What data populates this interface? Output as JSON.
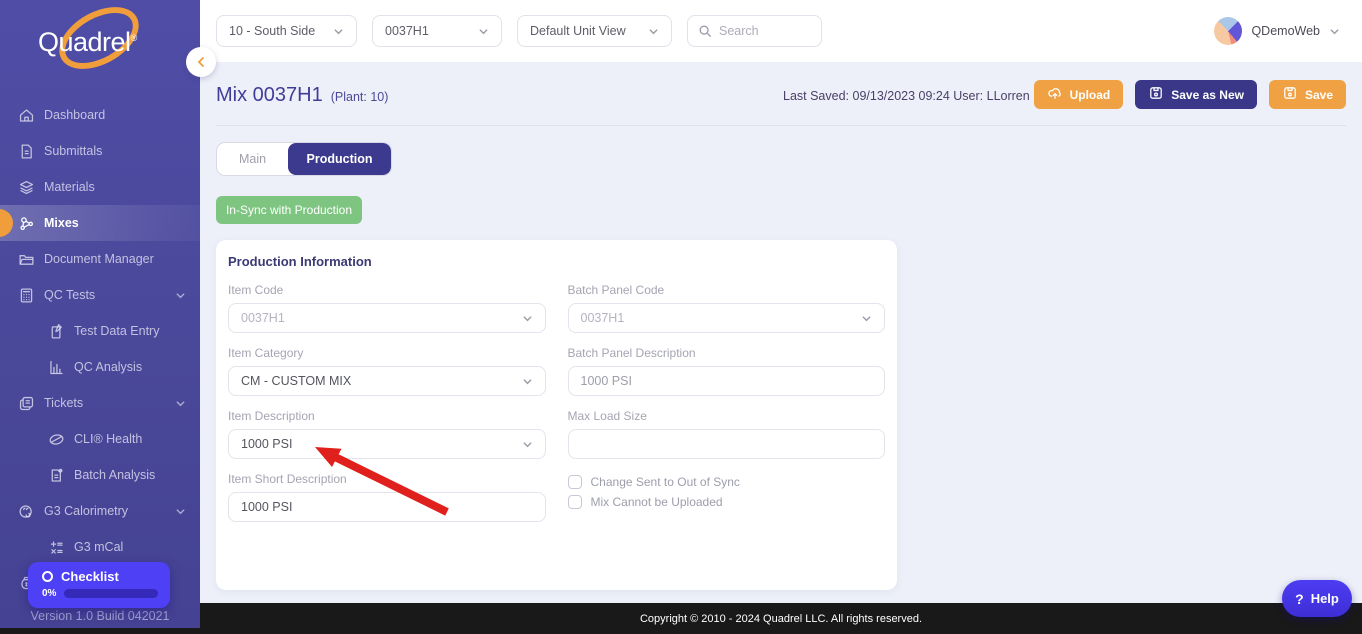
{
  "brand": {
    "logo_text": "Quadrel",
    "registered_mark": "®",
    "version": "Version 1.0 Build 042021"
  },
  "sidebar": {
    "items": [
      {
        "label": "Dashboard",
        "icon": "home-icon",
        "sub": false,
        "chevron": false,
        "active": false
      },
      {
        "label": "Submittals",
        "icon": "document-icon",
        "sub": false,
        "chevron": false,
        "active": false
      },
      {
        "label": "Materials",
        "icon": "layers-icon",
        "sub": false,
        "chevron": false,
        "active": false
      },
      {
        "label": "Mixes",
        "icon": "molecule-icon",
        "sub": false,
        "chevron": false,
        "active": true
      },
      {
        "label": "Document Manager",
        "icon": "folder-icon",
        "sub": false,
        "chevron": false,
        "active": false
      },
      {
        "label": "QC Tests",
        "icon": "calculator-icon",
        "sub": false,
        "chevron": true,
        "active": false
      },
      {
        "label": "Test Data Entry",
        "icon": "clipboard-edit-icon",
        "sub": true,
        "chevron": false,
        "active": false
      },
      {
        "label": "QC Analysis",
        "icon": "bar-chart-icon",
        "sub": true,
        "chevron": false,
        "active": false
      },
      {
        "label": "Tickets",
        "icon": "tickets-icon",
        "sub": false,
        "chevron": true,
        "active": false
      },
      {
        "label": "CLI® Health",
        "icon": "gauge-icon",
        "sub": true,
        "chevron": false,
        "active": false
      },
      {
        "label": "Batch Analysis",
        "icon": "doc-badge-icon",
        "sub": true,
        "chevron": false,
        "active": false
      },
      {
        "label": "G3 Calorimetry",
        "icon": "calorimeter-icon",
        "sub": false,
        "chevron": true,
        "active": false
      },
      {
        "label": "G3 mCal",
        "icon": "math-icon",
        "sub": true,
        "chevron": false,
        "active": false
      },
      {
        "label": "",
        "icon": "money-bag-icon",
        "sub": false,
        "chevron": false,
        "active": false
      }
    ],
    "checklist": {
      "label": "Checklist",
      "percent": "0%"
    }
  },
  "topbar": {
    "selects": [
      {
        "value": "10 - South Side"
      },
      {
        "value": "0037H1"
      },
      {
        "value": "Default Unit View"
      }
    ],
    "search_placeholder": "Search",
    "user": "QDemoWeb"
  },
  "header": {
    "title": "Mix 0037H1",
    "subtitle": "(Plant: 10)",
    "last_saved": "Last Saved: 09/13/2023 09:24 User: LLorren",
    "buttons": [
      {
        "label": "Upload",
        "icon": "cloud-upload-icon",
        "style": "orange"
      },
      {
        "label": "Save as New",
        "icon": "save-icon",
        "style": "indigo"
      },
      {
        "label": "Save",
        "icon": "save-icon",
        "style": "orange"
      }
    ]
  },
  "tabs": [
    {
      "label": "Main",
      "active": false
    },
    {
      "label": "Production",
      "active": true
    }
  ],
  "sync_badge": "In-Sync with Production",
  "form": {
    "title": "Production Information",
    "fields": [
      {
        "key": "item_code",
        "label": "Item Code",
        "value": "0037H1",
        "type": "select",
        "muted": true
      },
      {
        "key": "batch_panel_code",
        "label": "Batch Panel Code",
        "value": "0037H1",
        "type": "select",
        "muted": true
      },
      {
        "key": "item_category",
        "label": "Item Category",
        "value": "CM - CUSTOM MIX",
        "type": "select",
        "muted": false
      },
      {
        "key": "batch_panel_description",
        "label": "Batch Panel Description",
        "value": "1000 PSI",
        "type": "input",
        "muted": true
      },
      {
        "key": "item_description",
        "label": "Item Description",
        "value": "1000 PSI",
        "type": "select",
        "muted": false
      },
      {
        "key": "max_load_size",
        "label": "Max Load Size",
        "value": "",
        "type": "input",
        "muted": false
      },
      {
        "key": "item_short_description",
        "label": "Item Short Description",
        "value": "1000 PSI",
        "type": "input",
        "muted": false
      },
      {
        "key": "checkbox_group",
        "type": "checkboxes",
        "items": [
          {
            "label": "Change Sent to Out of Sync",
            "checked": false
          },
          {
            "label": "Mix Cannot be Uploaded",
            "checked": false
          }
        ]
      }
    ]
  },
  "footer": {
    "copyright": "Copyright © 2010 - 2024 Quadrel LLC. All rights reserved."
  },
  "help": {
    "question_mark": "?",
    "label": "Help"
  },
  "colors": {
    "sidebar": "#4A4899",
    "accent_orange": "#F0A144",
    "indigo_button": "#3A3788",
    "active_tab": "#3C3A8E",
    "sync_green": "#7EC581",
    "checklist_widget": "#4E40F4",
    "content_background": "#EDF0F8",
    "footer_black": "#191919",
    "annotation_red": "#E0201C",
    "heading_text": "#403D99"
  }
}
